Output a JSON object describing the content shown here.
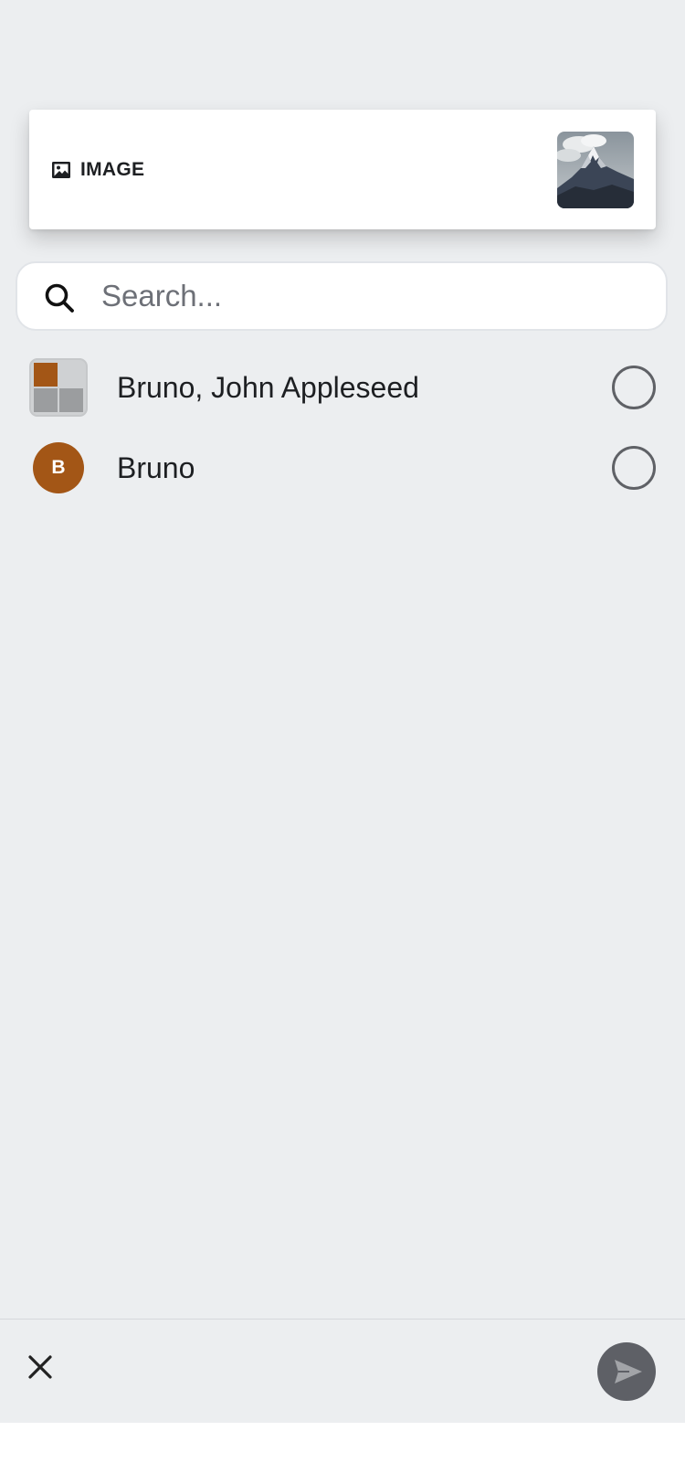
{
  "share_preview": {
    "type_icon": "image-icon",
    "type_label": "IMAGE",
    "thumbnail_description": "mountain-photo"
  },
  "search": {
    "icon": "search-icon",
    "placeholder": "Search...",
    "value": ""
  },
  "conversations": [
    {
      "name": "Bruno, John Appleseed",
      "avatar_type": "group",
      "avatar_colors": [
        "#A35616",
        "#cfd1d3",
        "#9b9d9f",
        "#9b9d9f"
      ],
      "selected": false
    },
    {
      "name": "Bruno",
      "avatar_type": "initial",
      "avatar_initial": "B",
      "avatar_color": "#A35616",
      "selected": false
    }
  ],
  "bottom_bar": {
    "close_icon": "close-icon",
    "send_icon": "send-icon",
    "send_enabled": false
  },
  "colors": {
    "background": "#ECEEF0",
    "avatar_brown": "#A35616",
    "send_button": "#5e6066"
  }
}
